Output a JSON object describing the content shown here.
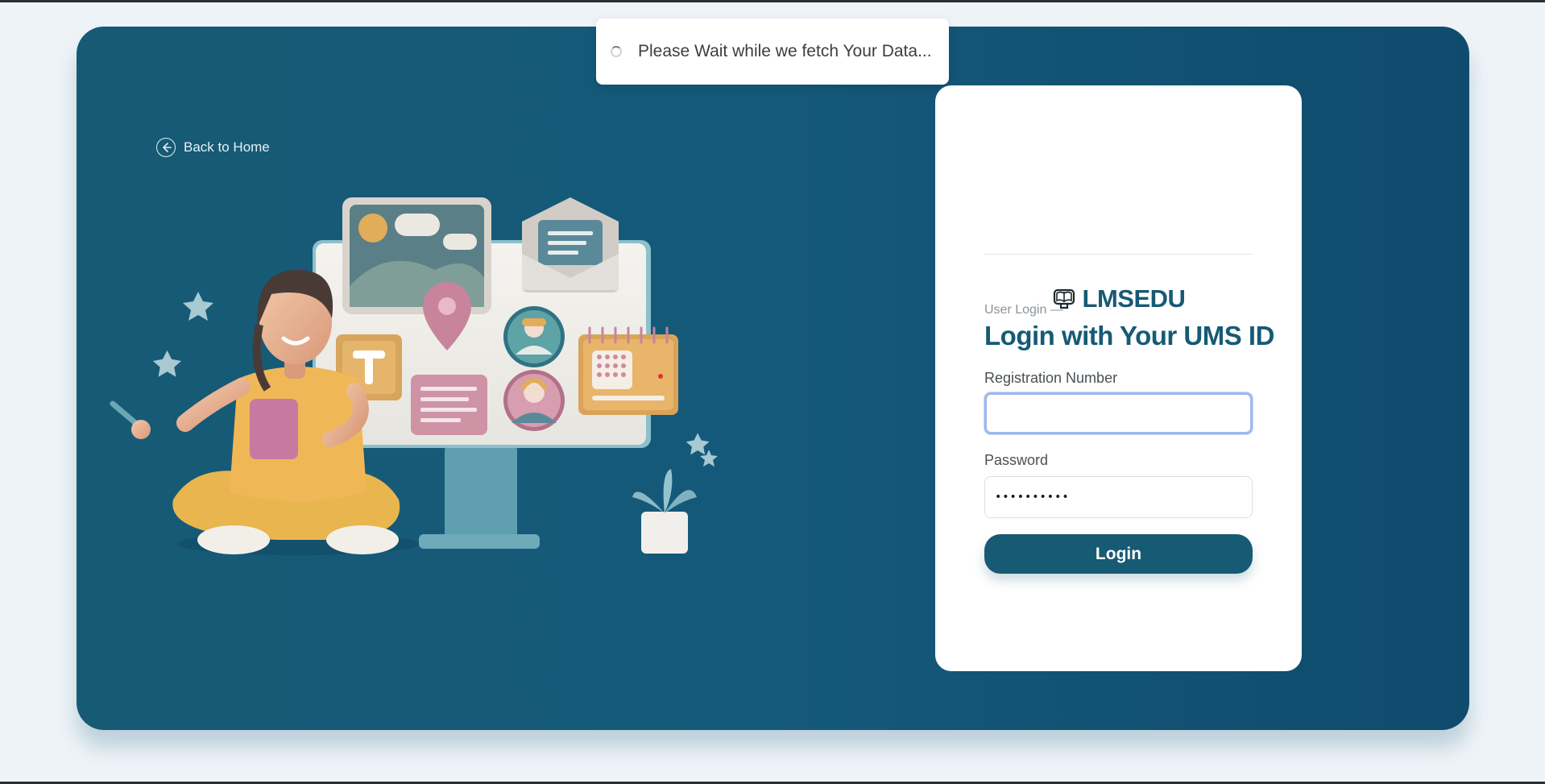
{
  "toast": {
    "message": "Please Wait while we fetch Your Data..."
  },
  "nav": {
    "back_label": "Back to Home"
  },
  "brand": {
    "name": "LMSEDU"
  },
  "login": {
    "subhead": "User Login —",
    "heading": "Login with Your UMS ID",
    "registration_label": "Registration Number",
    "registration_value": "",
    "password_label": "Password",
    "password_value": "••••••••••",
    "button_label": "Login"
  },
  "colors": {
    "accent": "#175a74",
    "background": "#eef3f8",
    "card": "#ffffff"
  }
}
